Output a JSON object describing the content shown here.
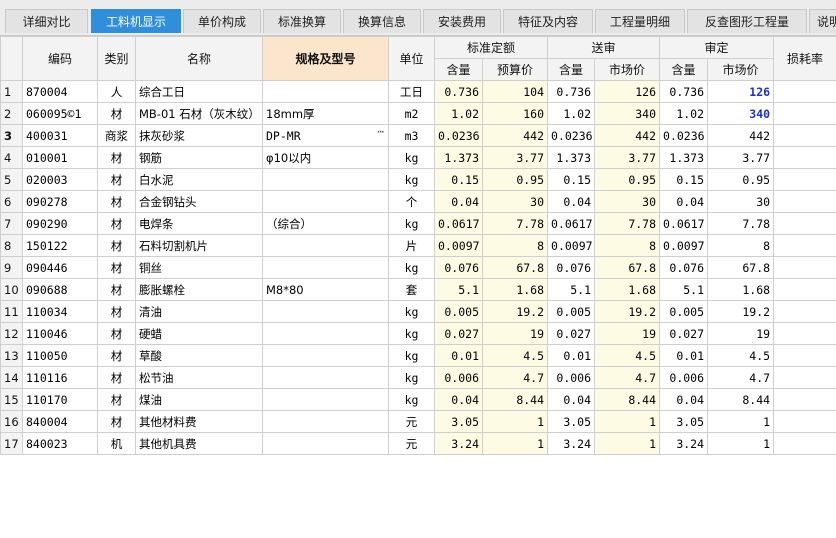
{
  "tabs": [
    {
      "label": "详细对比",
      "active": false
    },
    {
      "label": "工料机显示",
      "active": true
    },
    {
      "label": "单价构成",
      "active": false
    },
    {
      "label": "标准换算",
      "active": false
    },
    {
      "label": "换算信息",
      "active": false
    },
    {
      "label": "安装费用",
      "active": false
    },
    {
      "label": "特征及内容",
      "active": false
    },
    {
      "label": "工程量明细",
      "active": false
    },
    {
      "label": "反查图形工程量",
      "active": false
    },
    {
      "label": "说明",
      "active": false
    }
  ],
  "headers": {
    "code": "编码",
    "category": "类别",
    "name": "名称",
    "spec": "规格及型号",
    "unit": "单位",
    "std_group": "标准定额",
    "sub_group": "送审",
    "appr_group": "审定",
    "loss": "损耗率",
    "qty": "含量",
    "budget_price": "预算价",
    "market_price": "市场价"
  },
  "rows": [
    {
      "no": "1",
      "code": "870004",
      "cat": "人",
      "name": "综合工日",
      "spec": "",
      "unit": "工日",
      "q1": "0.736",
      "p1": "104",
      "q2": "0.736",
      "p2": "126",
      "q3": "0.736",
      "p3": "126",
      "p3_highlight": true
    },
    {
      "no": "2",
      "code": "060095©1",
      "cat": "材",
      "name": "MB-01 石材（灰木纹）",
      "spec": "18mm厚",
      "unit": "m2",
      "q1": "1.02",
      "p1": "160",
      "q2": "1.02",
      "p2": "340",
      "q3": "1.02",
      "p3": "340",
      "p3_highlight": true
    },
    {
      "no": "3",
      "code": "400031",
      "cat": "商浆",
      "name": "抹灰砂浆",
      "spec": "DP-MR",
      "unit": "m3",
      "q1": "0.0236",
      "p1": "442",
      "q2": "0.0236",
      "p2": "442",
      "q3": "0.0236",
      "p3": "442",
      "selected": true
    },
    {
      "no": "4",
      "code": "010001",
      "cat": "材",
      "name": "钢筋",
      "spec": "φ10以内",
      "unit": "kg",
      "q1": "1.373",
      "p1": "3.77",
      "q2": "1.373",
      "p2": "3.77",
      "q3": "1.373",
      "p3": "3.77"
    },
    {
      "no": "5",
      "code": "020003",
      "cat": "材",
      "name": "白水泥",
      "spec": "",
      "unit": "kg",
      "q1": "0.15",
      "p1": "0.95",
      "q2": "0.15",
      "p2": "0.95",
      "q3": "0.15",
      "p3": "0.95"
    },
    {
      "no": "6",
      "code": "090278",
      "cat": "材",
      "name": "合金钢钻头",
      "spec": "",
      "unit": "个",
      "q1": "0.04",
      "p1": "30",
      "q2": "0.04",
      "p2": "30",
      "q3": "0.04",
      "p3": "30"
    },
    {
      "no": "7",
      "code": "090290",
      "cat": "材",
      "name": "电焊条",
      "spec": "（综合）",
      "unit": "kg",
      "q1": "0.0617",
      "p1": "7.78",
      "q2": "0.0617",
      "p2": "7.78",
      "q3": "0.0617",
      "p3": "7.78"
    },
    {
      "no": "8",
      "code": "150122",
      "cat": "材",
      "name": "石料切割机片",
      "spec": "",
      "unit": "片",
      "q1": "0.0097",
      "p1": "8",
      "q2": "0.0097",
      "p2": "8",
      "q3": "0.0097",
      "p3": "8"
    },
    {
      "no": "9",
      "code": "090446",
      "cat": "材",
      "name": "铜丝",
      "spec": "",
      "unit": "kg",
      "q1": "0.076",
      "p1": "67.8",
      "q2": "0.076",
      "p2": "67.8",
      "q3": "0.076",
      "p3": "67.8"
    },
    {
      "no": "10",
      "code": "090688",
      "cat": "材",
      "name": "膨胀螺栓",
      "spec": "M8*80",
      "unit": "套",
      "q1": "5.1",
      "p1": "1.68",
      "q2": "5.1",
      "p2": "1.68",
      "q3": "5.1",
      "p3": "1.68"
    },
    {
      "no": "11",
      "code": "110034",
      "cat": "材",
      "name": "清油",
      "spec": "",
      "unit": "kg",
      "q1": "0.005",
      "p1": "19.2",
      "q2": "0.005",
      "p2": "19.2",
      "q3": "0.005",
      "p3": "19.2"
    },
    {
      "no": "12",
      "code": "110046",
      "cat": "材",
      "name": "硬蜡",
      "spec": "",
      "unit": "kg",
      "q1": "0.027",
      "p1": "19",
      "q2": "0.027",
      "p2": "19",
      "q3": "0.027",
      "p3": "19"
    },
    {
      "no": "13",
      "code": "110050",
      "cat": "材",
      "name": "草酸",
      "spec": "",
      "unit": "kg",
      "q1": "0.01",
      "p1": "4.5",
      "q2": "0.01",
      "p2": "4.5",
      "q3": "0.01",
      "p3": "4.5"
    },
    {
      "no": "14",
      "code": "110116",
      "cat": "材",
      "name": "松节油",
      "spec": "",
      "unit": "kg",
      "q1": "0.006",
      "p1": "4.7",
      "q2": "0.006",
      "p2": "4.7",
      "q3": "0.006",
      "p3": "4.7"
    },
    {
      "no": "15",
      "code": "110170",
      "cat": "材",
      "name": "煤油",
      "spec": "",
      "unit": "kg",
      "q1": "0.04",
      "p1": "8.44",
      "q2": "0.04",
      "p2": "8.44",
      "q3": "0.04",
      "p3": "8.44"
    },
    {
      "no": "16",
      "code": "840004",
      "cat": "材",
      "name": "其他材料费",
      "spec": "",
      "unit": "元",
      "q1": "3.05",
      "p1": "1",
      "q2": "3.05",
      "p2": "1",
      "q3": "3.05",
      "p3": "1"
    },
    {
      "no": "17",
      "code": "840023",
      "cat": "机",
      "name": "其他机具费",
      "spec": "",
      "unit": "元",
      "q1": "3.24",
      "p1": "1",
      "q2": "3.24",
      "p2": "1",
      "q3": "3.24",
      "p3": "1"
    }
  ],
  "colors": {
    "active_tab": "#2f8fdb",
    "spec_header": "#fbe6cd",
    "price_highlight": "#1b2fd6",
    "price_cell_bg": "#fdfbe3"
  }
}
